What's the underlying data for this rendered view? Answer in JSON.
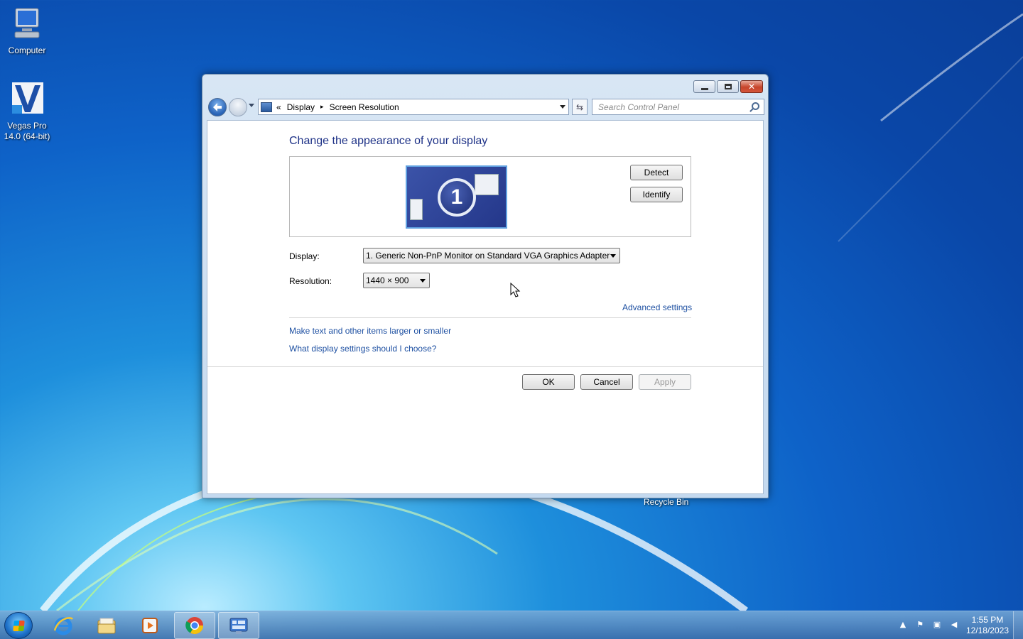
{
  "desktop": {
    "icons": [
      {
        "label": "Computer"
      },
      {
        "label_line1": "Vegas Pro",
        "label_line2": "14.0 (64-bit)"
      }
    ],
    "recycle_bin_label": "Recycle Bin"
  },
  "window": {
    "address": {
      "overflow": "«",
      "crumbs": [
        "Display",
        "Screen Resolution"
      ],
      "separator": "▸"
    },
    "search_placeholder": "Search Control Panel",
    "heading": "Change the appearance of your display",
    "monitor_number": "1",
    "detect_label": "Detect",
    "identify_label": "Identify",
    "display_label": "Display:",
    "display_value": "1. Generic Non-PnP Monitor on Standard VGA Graphics Adapter",
    "resolution_label": "Resolution:",
    "resolution_value": "1440 × 900",
    "advanced_link": "Advanced settings",
    "links": [
      "Make text and other items larger or smaller",
      "What display settings should I choose?"
    ],
    "ok_label": "OK",
    "cancel_label": "Cancel",
    "apply_label": "Apply"
  },
  "taskbar": {
    "clock_time": "1:55 PM",
    "clock_date": "12/18/2023",
    "items": [
      "internet-explorer",
      "file-explorer",
      "media-player",
      "chrome",
      "control-panel"
    ]
  },
  "colors": {
    "heading": "#1e3287",
    "link": "#1e50a2",
    "accent": "#0e62c8"
  }
}
